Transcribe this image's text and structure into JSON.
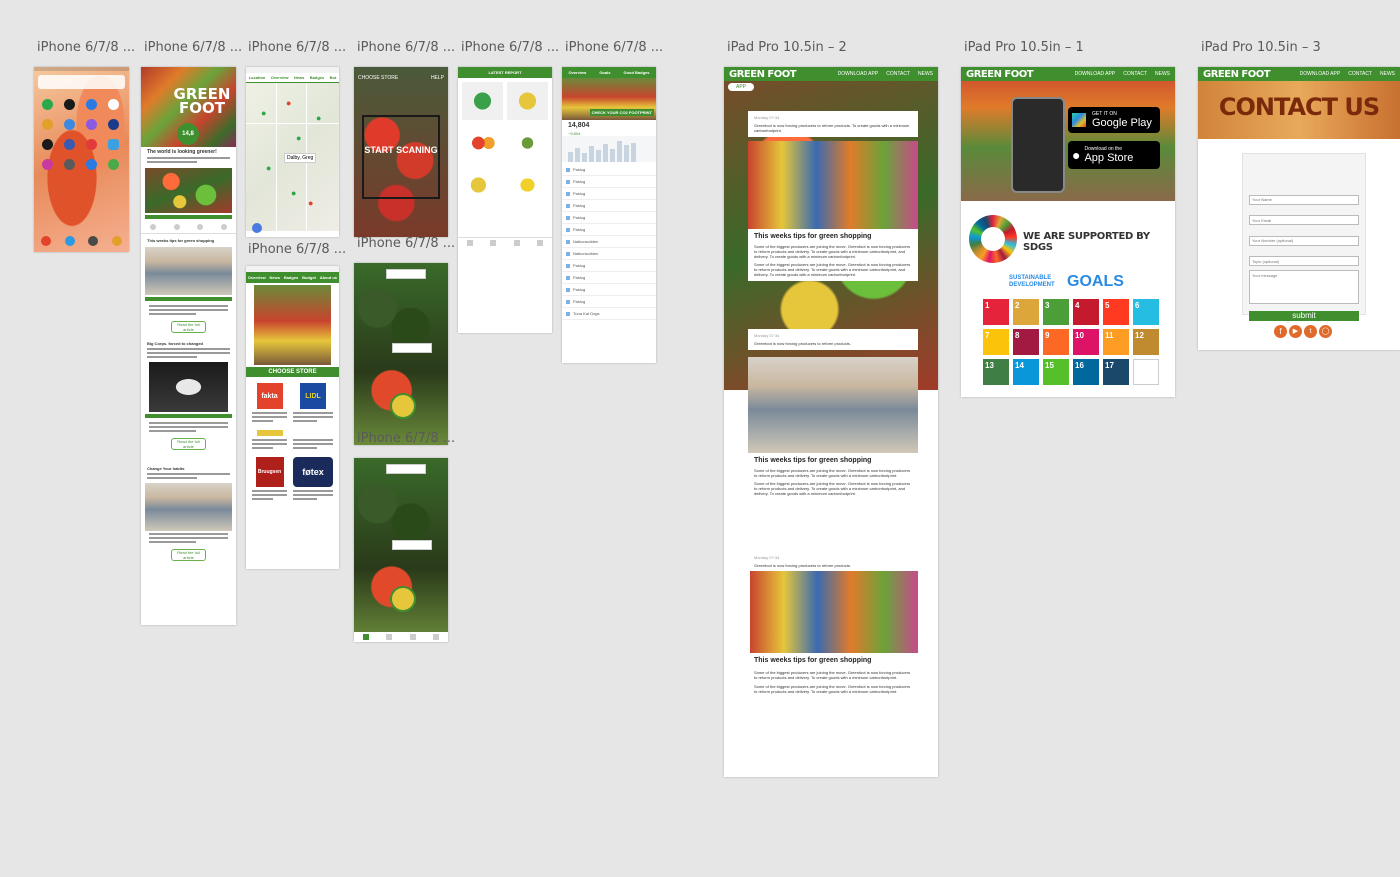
{
  "labels": {
    "iphone1": "iPhone 6/7/8 ...",
    "iphone2": "iPhone 6/7/8 ...",
    "iphone3": "iPhone 6/7/8 ...",
    "iphone4": "iPhone 6/7/8 ...",
    "iphone5": "iPhone 6/7/8 ...",
    "iphone6": "iPhone 6/7/8 ...",
    "ipad2": "iPad Pro 10.5in – 2",
    "ipad1": "iPad Pro 10.5in – 1",
    "ipad3": "iPad Pro 10.5in – 3",
    "sub_iphone3": "iPhone 6/7/8 ...",
    "sub_iphone4a": "iPhone 6/7/8 ...",
    "sub_iphone4b": "iPhone 6/7/8 ..."
  },
  "brand": "GREEN FOOT",
  "nav": {
    "download": "DOWNLOAD APP",
    "contact": "CONTACT",
    "news": "NEWS"
  },
  "ipad2": {
    "app_tag": "APP",
    "posts": [
      {
        "date": "Monday 07:34",
        "lead": "Greenfoot is now forcing producers to reform products. To create goods with a minimum carbonfootprint.",
        "title": "This weeks tips for green shopping",
        "body1": "Some of the biggest producers are joining the move. Greenfoot is now forcing producers to reform products and delivery. To create goods with a minimum carbonfootprint, and delivery. To create goods with a minimum carbonfootprint.",
        "body2": "Some of the biggest producers are joining the move. Greenfoot is now forcing producers to reform products and delivery. To create goods with a minimum carbonfootprint, and delivery. To create goods with a minimum carbonfootprint."
      },
      {
        "date": "Monday 07:34",
        "lead": "Greenfoot is now forcing producers to reform products.",
        "title": "This weeks tips for green shopping",
        "body1": "Some of the biggest producers are joining the move. Greenfoot is now forcing producers to reform products and delivery. To create goods with a minimum carbonfootprint.",
        "body2": "Some of the biggest producers are joining the move. Greenfoot is now forcing producers to reform products and delivery. To create goods with a minimum carbonfootprint, and delivery. To create goods with a minimum carbonfootprint."
      },
      {
        "date": "Monday 07:34",
        "lead": "Greenfoot is now forcing producers to reform products.",
        "title": "This weeks tips for green shopping",
        "body1": "Some of the biggest producers are joining the move. Greenfoot is now forcing producers to reform products and delivery. To create goods with a minimum carbonfootprint.",
        "body2": "Some of the biggest producers are joining the move. Greenfoot is now forcing producers to reform products and delivery. To create goods with a minimum carbonfootprint."
      }
    ]
  },
  "ipad1": {
    "google_small": "GET IT ON",
    "google_big": "Google Play",
    "apple_small": "Download on the",
    "apple_big": "App Store",
    "supported": "WE ARE SUPPORTED BY SDGS",
    "sdg_small": "SUSTAINABLE DEVELOPMENT",
    "sdg_big": "GOALS",
    "sdg_tiles": [
      {
        "n": "1",
        "c": "#e5243b"
      },
      {
        "n": "2",
        "c": "#dda63a"
      },
      {
        "n": "3",
        "c": "#4c9f38"
      },
      {
        "n": "4",
        "c": "#c5192d"
      },
      {
        "n": "5",
        "c": "#ff3a21"
      },
      {
        "n": "6",
        "c": "#26bde2"
      },
      {
        "n": "7",
        "c": "#fcc30b"
      },
      {
        "n": "8",
        "c": "#a21942"
      },
      {
        "n": "9",
        "c": "#fd6925"
      },
      {
        "n": "10",
        "c": "#dd1367"
      },
      {
        "n": "11",
        "c": "#fd9d24"
      },
      {
        "n": "12",
        "c": "#bf8b2e"
      },
      {
        "n": "13",
        "c": "#3f7e44"
      },
      {
        "n": "14",
        "c": "#0a97d9"
      },
      {
        "n": "15",
        "c": "#56c02b"
      },
      {
        "n": "16",
        "c": "#00689d"
      },
      {
        "n": "17",
        "c": "#19486a"
      },
      {
        "n": "",
        "c": "#ffffff"
      }
    ]
  },
  "ipad3": {
    "hero": "CONTACT US",
    "name_ph": "Your Name",
    "email_ph": "Your Email",
    "number_ph": "Your Number (optional)",
    "topic_ph": "Topic (optional)",
    "message_ph": "Your message",
    "submit": "submit"
  },
  "phone2": {
    "title": "GREEN FOOT",
    "score": "14,8",
    "headline1": "The world is looking greener!",
    "section": "This weeks tips for green shopping",
    "headline2": "Big Corps. forced to changed",
    "headline3": "Change Your habits",
    "read_more": "Read the full article"
  },
  "phone3": {
    "tabs": [
      "Location",
      "Overview",
      "News",
      "Badges",
      "Bot"
    ],
    "place": "Dalby, Greg",
    "choose_store": "CHOOSE STORE",
    "stores": [
      "fakta",
      "LIDL",
      "Bruugsen",
      "føtex"
    ],
    "tabs2": [
      "Overview",
      "News",
      "Badges",
      "Budget",
      "About us"
    ]
  },
  "phone4": {
    "header": "CHOOSE STORE",
    "help": "HELP",
    "cta": "START SCANING"
  },
  "phone5": {
    "header": "LATEST REPORT"
  },
  "phone6": {
    "tabs": [
      "Overview",
      "Goals",
      "Good Badges"
    ],
    "banner": "CHECK YOUR CO2 FOOTPRINT",
    "value": "14,804",
    "value2": "~9,804",
    "items": [
      "Paklog",
      "Paklog",
      "Paklog",
      "Paklog",
      "Paklog",
      "Paklog",
      "Natkonsoliden",
      "Natkonsoliden",
      "Paklog",
      "Paklog",
      "Paklog",
      "Paklog",
      "Tuna Kat Dogs"
    ]
  }
}
